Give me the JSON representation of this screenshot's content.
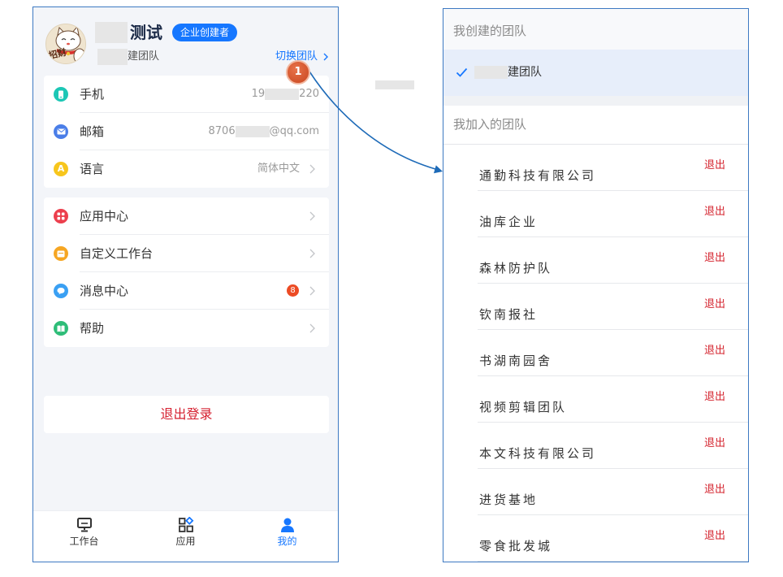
{
  "profile": {
    "avatar_lettering": "招财",
    "name": "测试",
    "role_badge": "企业创建者",
    "team": "建团队",
    "switch_team": "切换团队"
  },
  "annotation": {
    "step": "1"
  },
  "account_rows": [
    {
      "label": "手机",
      "value_start": "19",
      "value_end": "220",
      "icon": "phone-icon",
      "color": "#1cc7b5"
    },
    {
      "label": "邮箱",
      "value_start": "8706",
      "value_end": "@qq.com",
      "icon": "mail-icon",
      "color": "#4a7ee8"
    },
    {
      "label": "语言",
      "value": "简体中文",
      "icon": "language-icon",
      "icon_glyph": "A",
      "color": "#f7c61d"
    }
  ],
  "menu_rows": [
    {
      "label": "应用中心",
      "icon": "apps-icon",
      "color": "#ec3f4d"
    },
    {
      "label": "自定义工作台",
      "icon": "workspace-icon",
      "color": "#f6a623"
    },
    {
      "label": "消息中心",
      "icon": "message-icon",
      "color": "#3aa0f3",
      "badge": "8"
    },
    {
      "label": "帮助",
      "icon": "help-book-icon",
      "color": "#2ebd78"
    }
  ],
  "logout": "退出登录",
  "tabbar": [
    {
      "label": "工作台",
      "icon": "monitor-icon",
      "active": false
    },
    {
      "label": "应用",
      "icon": "apps-grid-icon",
      "active": false
    },
    {
      "label": "我的",
      "icon": "person-icon",
      "active": true
    }
  ],
  "team_switcher": {
    "created_header": "我创建的团队",
    "created_team": "建团队",
    "selected_icon": "check-icon",
    "joined_header": "我加入的团队",
    "joined_teams": [
      {
        "name": "通勤科技有限公司",
        "action": "退出"
      },
      {
        "name": "油库企业",
        "action": "退出"
      },
      {
        "name": "森林防护队",
        "action": "退出"
      },
      {
        "name": "钦南报社",
        "action": "退出"
      },
      {
        "name": "书湖南园舍",
        "action": "退出"
      },
      {
        "name": "视频剪辑团队",
        "action": "退出"
      },
      {
        "name": "本文科技有限公司",
        "action": "退出"
      },
      {
        "name": "进货基地",
        "action": "退出"
      },
      {
        "name": "零食批发城",
        "action": "退出"
      }
    ]
  },
  "colors": {
    "accent": "#1677ff",
    "danger": "#d51f2f",
    "frame_border": "#3d79c2",
    "selected_bg": "#e7eefa",
    "annotation_arrow": "#1e6bb8",
    "annotation_step": "#d0532a"
  }
}
